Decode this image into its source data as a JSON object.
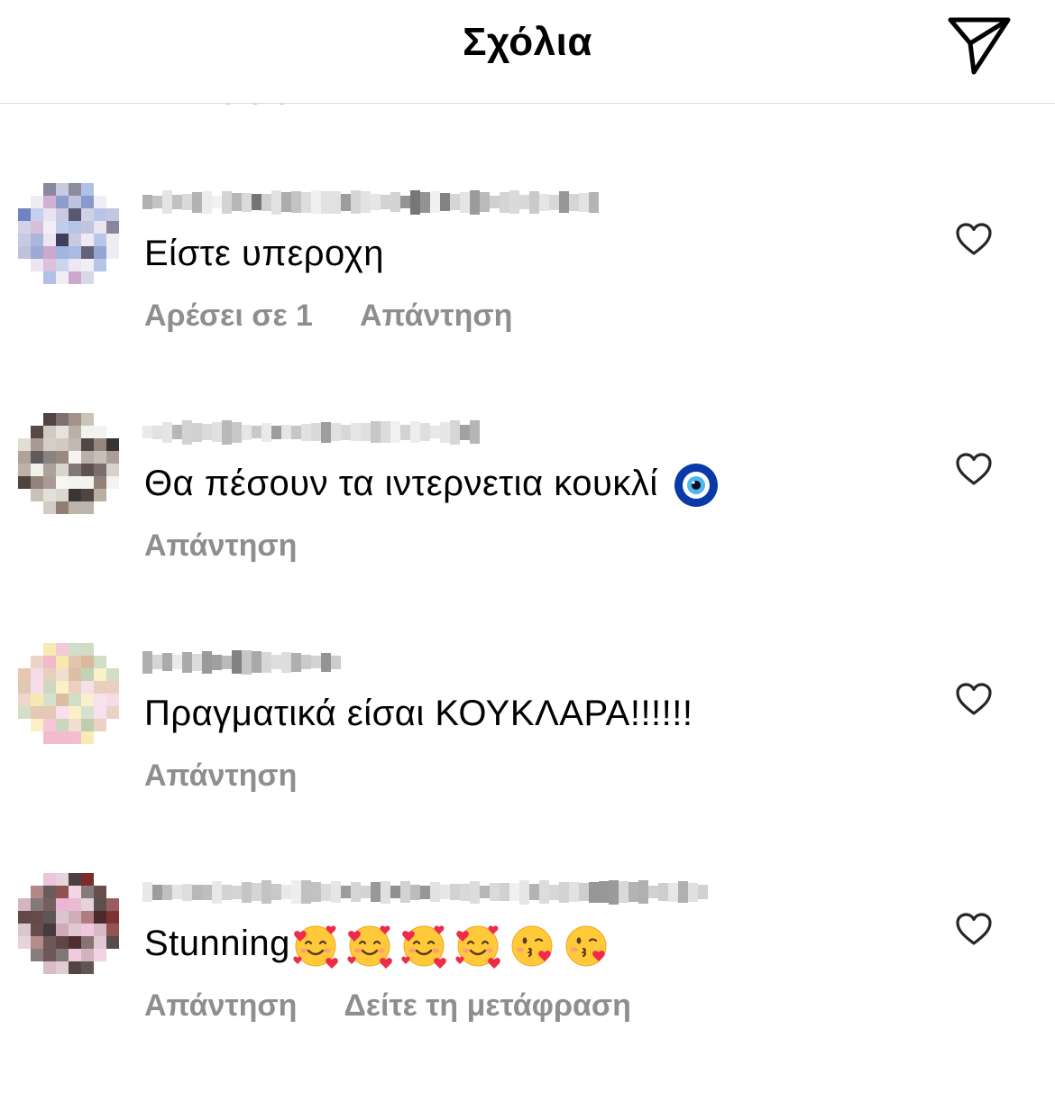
{
  "header": {
    "title": "Σχόλια",
    "share_icon": "paper-plane-icon"
  },
  "comments": [
    {
      "username": "",
      "text": "Είστε υπεροχη",
      "emoji": [],
      "likes_label": "Αρέσει σε 1",
      "reply_label": "Απάντηση",
      "translate_label": "",
      "like_icon": "heart-outline-icon",
      "avatar_palette": [
        "#6a7fbf",
        "#b6b8d8",
        "#e8e2ee",
        "#3b3b58",
        "#c9a3c9",
        "#9fb3e0"
      ]
    },
    {
      "username": "",
      "text": "Θα πέσουν τα ιντερνετια κουκλί",
      "emoji": [
        "nazar-amulet"
      ],
      "likes_label": "",
      "reply_label": "Απάντηση",
      "translate_label": "",
      "like_icon": "heart-outline-icon",
      "avatar_palette": [
        "#f1f1ec",
        "#d6d3c8",
        "#4a3d3a",
        "#8c7a70",
        "#b8aea2",
        "#2a2426"
      ]
    },
    {
      "username": "",
      "text": "Πραγματικά είσαι ΚΟΥΚΛΑΡΑ!!!!!!",
      "emoji": [],
      "likes_label": "",
      "reply_label": "Απάντηση",
      "translate_label": "",
      "like_icon": "heart-outline-icon",
      "avatar_palette": [
        "#f4d7e6",
        "#f7e7a8",
        "#e7c6b4",
        "#b7c9a5",
        "#f0b3c8",
        "#d9b79a"
      ]
    },
    {
      "username": "",
      "text": "Stunning",
      "emoji": [
        "smiling-face-with-hearts",
        "smiling-face-with-hearts",
        "smiling-face-with-hearts",
        "smiling-face-with-hearts",
        "face-blowing-kiss",
        "face-blowing-kiss"
      ],
      "likes_label": "",
      "reply_label": "Απάντηση",
      "translate_label": "Δείτε τη μετάφραση",
      "like_icon": "heart-outline-icon",
      "avatar_palette": [
        "#e9b3cf",
        "#4a2a2a",
        "#7a2c2c",
        "#c9a0b0",
        "#2e1f1f",
        "#d8c0c8"
      ]
    }
  ]
}
